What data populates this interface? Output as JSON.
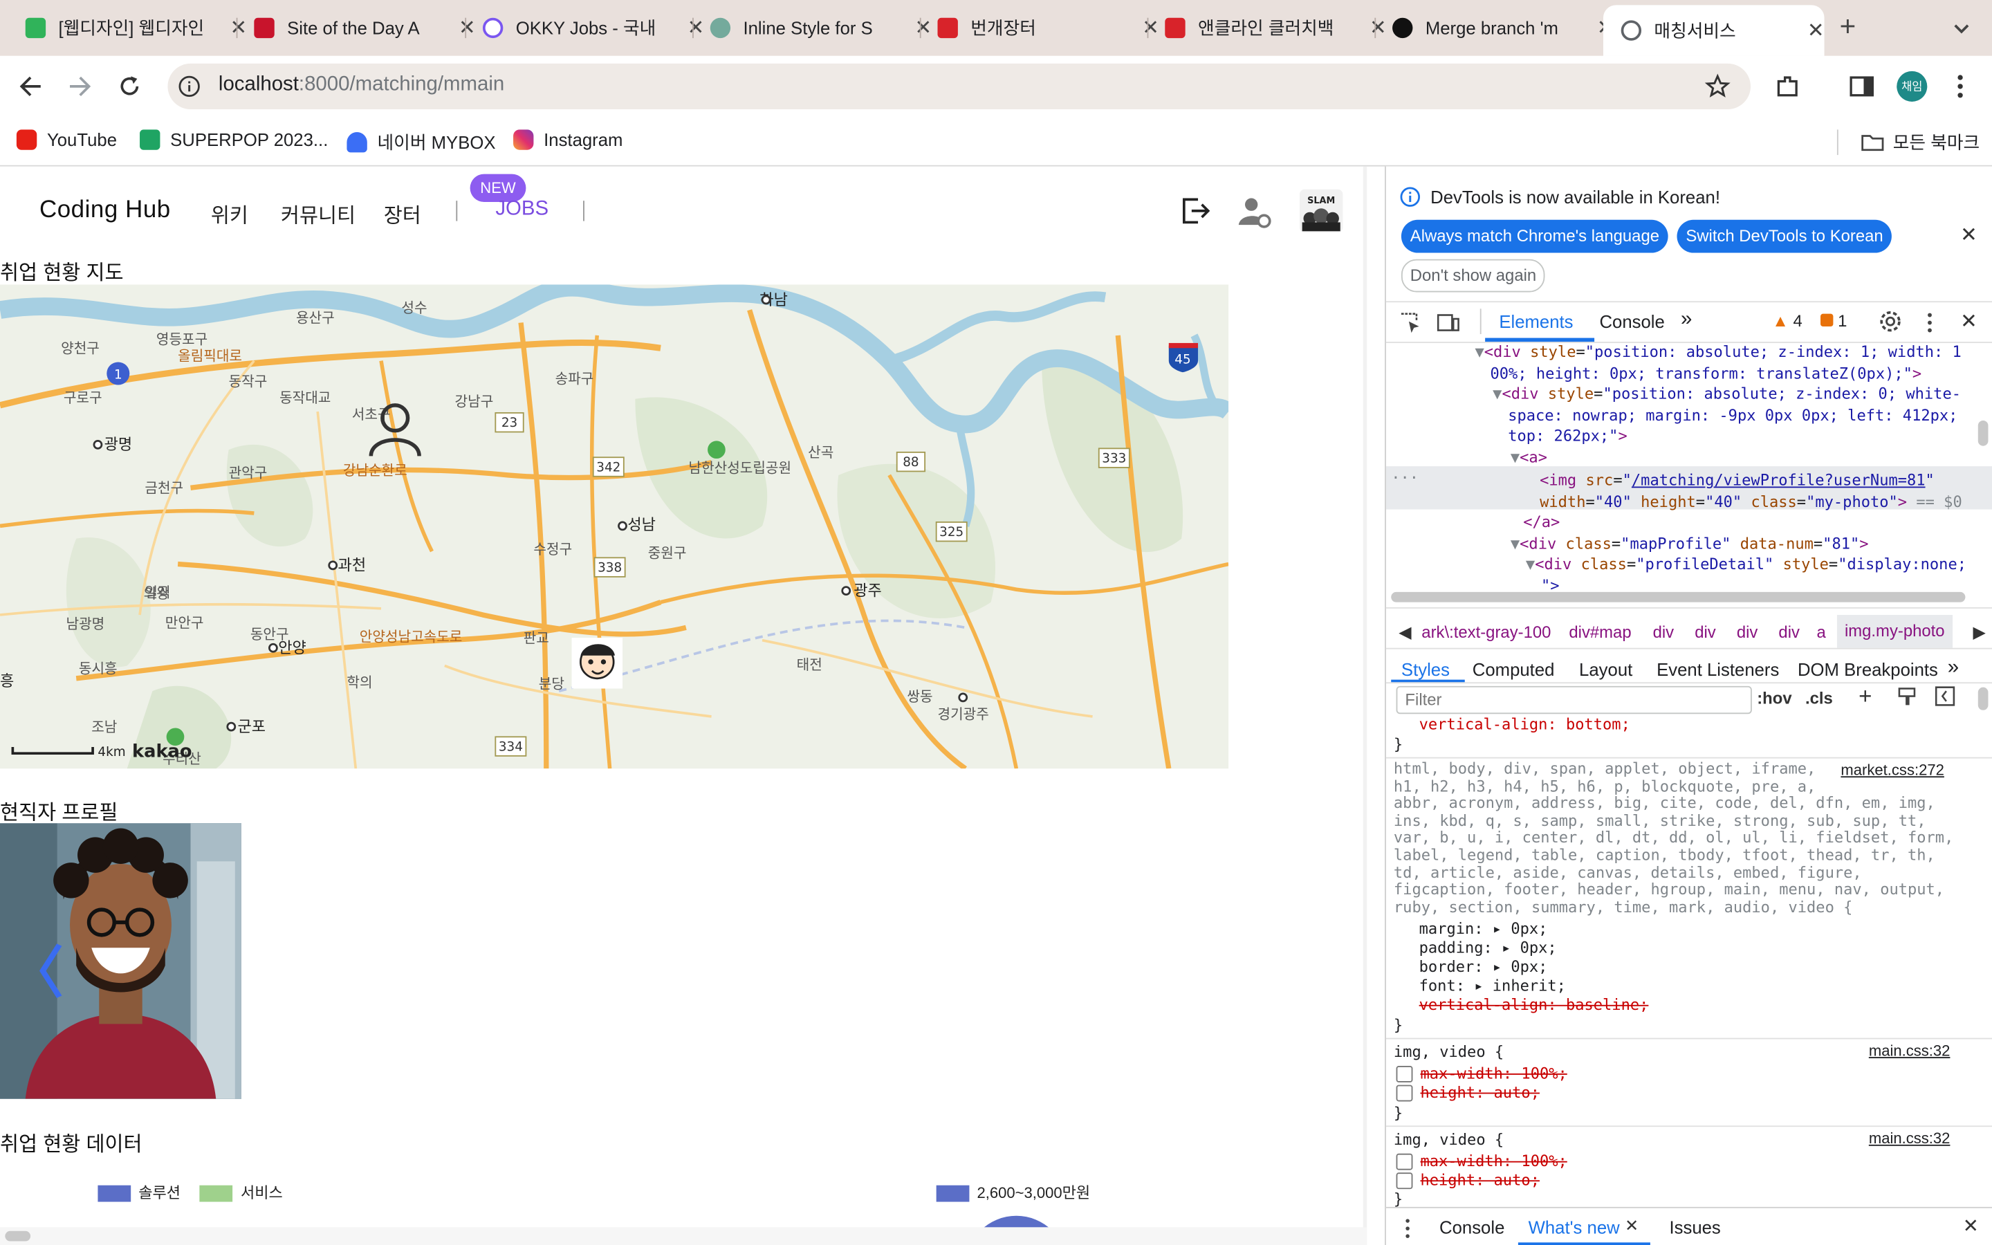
{
  "browser": {
    "tabs": [
      {
        "title": "[웹디자인] 웹디자인",
        "color": "#30b35a"
      },
      {
        "title": "Site of the Day A",
        "color": "#c8142c"
      },
      {
        "title": "OKKY Jobs - 국내",
        "color": "#7a56f0"
      },
      {
        "title": "Inline Style for S",
        "color": "#74aa9c"
      },
      {
        "title": "번개장터",
        "color": "#d8232a"
      },
      {
        "title": "앤클라인 클러치백",
        "color": "#d8232a"
      },
      {
        "title": "Merge branch 'm",
        "color": "#111111"
      },
      {
        "title": "매칭서비스",
        "color": "#5f6368"
      }
    ],
    "close_glyph": "✕",
    "new_tab_glyph": "+",
    "url_host": "localhost",
    "url_path": ":8000/matching/mmain",
    "profile_label": "채임",
    "bookmarks": [
      "YouTube",
      "SUPERPOP 2023...",
      "네이버 MYBOX",
      "Instagram"
    ],
    "all_bookmarks": "모든 북마크"
  },
  "site": {
    "logo": "Coding Hub",
    "nav": [
      "위키",
      "커뮤니티",
      "장터"
    ],
    "new_badge": "NEW",
    "jobs": "JOBS",
    "section_map": "취업 현황 지도",
    "section_profile": "현직자 프로필",
    "section_data": "취업 현황 데이터",
    "legend_left": [
      "솔루션",
      "서비스"
    ],
    "legend_right": [
      "2,600~3,000만원"
    ],
    "legend_colors": {
      "solution": "#5b6ec7",
      "service": "#9fd18c",
      "salary": "#5b6ec7"
    },
    "accent": "#8d5cf0",
    "profile_prev_glyph": "〈"
  },
  "map": {
    "scale": "4km",
    "brand": "kakao",
    "labels": [
      "하남",
      "용산구",
      "성수",
      "양천구",
      "영등포구",
      "올림픽대로",
      "동작구",
      "구로구",
      "서초구",
      "강남구",
      "송파구",
      "광명",
      "관악구",
      "금천구",
      "강남순환로",
      "남한산성도립공원",
      "산곡",
      "성남",
      "수정구",
      "중원구",
      "과천",
      "광주",
      "의왕",
      "만안구",
      "동안구",
      "안양",
      "안양성남고속도로",
      "판교",
      "분당",
      "태전",
      "쌍동",
      "경기광주",
      "학의",
      "군포",
      "조남",
      "동시흥",
      "흥",
      "수리산",
      "일직",
      "남광명",
      "동작대교"
    ],
    "route_numbers": [
      "1",
      "23",
      "342",
      "338",
      "88",
      "325",
      "333",
      "45",
      "334"
    ]
  },
  "devtools": {
    "banner": "DevTools is now available in Korean!",
    "btn_match": "Always match Chrome's language",
    "btn_switch": "Switch DevTools to Korean",
    "btn_dont": "Don't show again",
    "tabs": [
      "Elements",
      "Console"
    ],
    "warn_count": "4",
    "err_count": "1",
    "breadcrumb": [
      "ark\\:text-gray-100",
      "div#map",
      "div",
      "div",
      "div",
      "div",
      "a",
      "img.my-photo"
    ],
    "subtabs": [
      "Styles",
      "Computed",
      "Layout",
      "Event Listeners",
      "DOM Breakpoints"
    ],
    "filter_placeholder": "Filter",
    "hov": ":hov",
    "cls": ".cls",
    "rule1": "vertical-align: bottom;",
    "reset_selectors": "html, body, div, span, applet, object, iframe,\nh1, h2, h3, h4, h5, h6, p, blockquote, pre, a,\nabbr, acronym, address, big, cite, code, del, dfn, em, img,\nins, kbd, q, s, samp, small, strike, strong, sub, sup, tt,\nvar, b, u, i, center, dl, dt, dd, ol, ul, li, fieldset, form,\nlabel, legend, table, caption, tbody, tfoot, thead, tr, th,\ntd, article, aside, canvas, details, embed, figure,\nfigcaption, footer, header, hgroup, main, menu, nav, output,\nruby, section, summary, time, mark, audio, video {",
    "reset_source": "market.css:272",
    "reset_props": [
      "margin: ▸ 0px;",
      "padding: ▸ 0px;",
      "border: ▸ 0px;",
      "font: ▸ inherit;"
    ],
    "reset_struck": "vertical-align: baseline;",
    "img_selector": "img, video {",
    "img_source": "main.css:32",
    "img_props": [
      "max-width: 100%;",
      "height: auto;"
    ],
    "drawer": [
      "Console",
      "What's new",
      "Issues"
    ]
  }
}
